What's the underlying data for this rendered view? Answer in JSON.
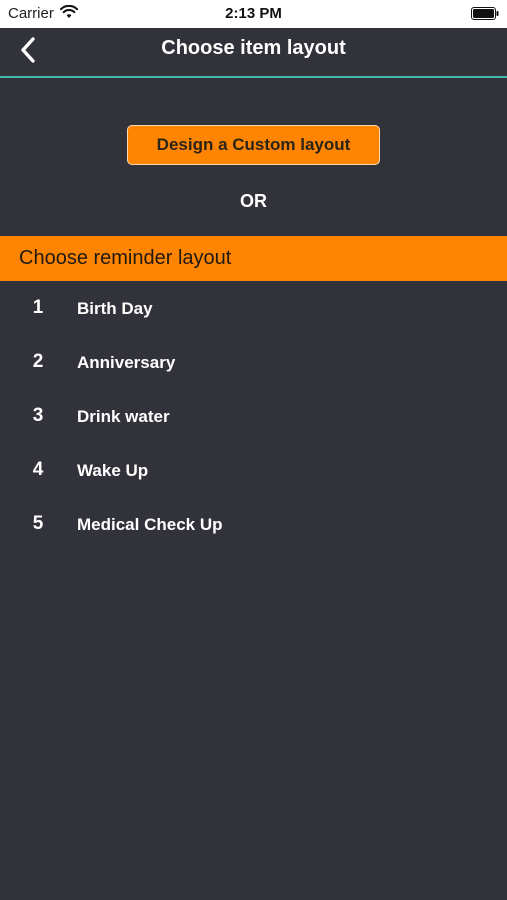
{
  "status_bar": {
    "carrier": "Carrier",
    "time": "2:13 PM",
    "wifi_icon": "wifi-icon",
    "battery_icon": "battery-icon"
  },
  "nav": {
    "back_icon": "chevron-left-icon",
    "title": "Choose item layout"
  },
  "custom": {
    "button_label": "Design a Custom layout",
    "or_label": "OR"
  },
  "section": {
    "header": "Choose reminder layout"
  },
  "layouts": [
    {
      "number": "1",
      "label": "Birth Day"
    },
    {
      "number": "2",
      "label": "Anniversary"
    },
    {
      "number": "3",
      "label": "Drink water"
    },
    {
      "number": "4",
      "label": "Wake Up"
    },
    {
      "number": "5",
      "label": "Medical Check Up"
    }
  ],
  "colors": {
    "background": "#31323a",
    "accent_orange": "#ff8400",
    "divider_teal": "#3fb9a8",
    "status_bar": "#ffffff"
  }
}
